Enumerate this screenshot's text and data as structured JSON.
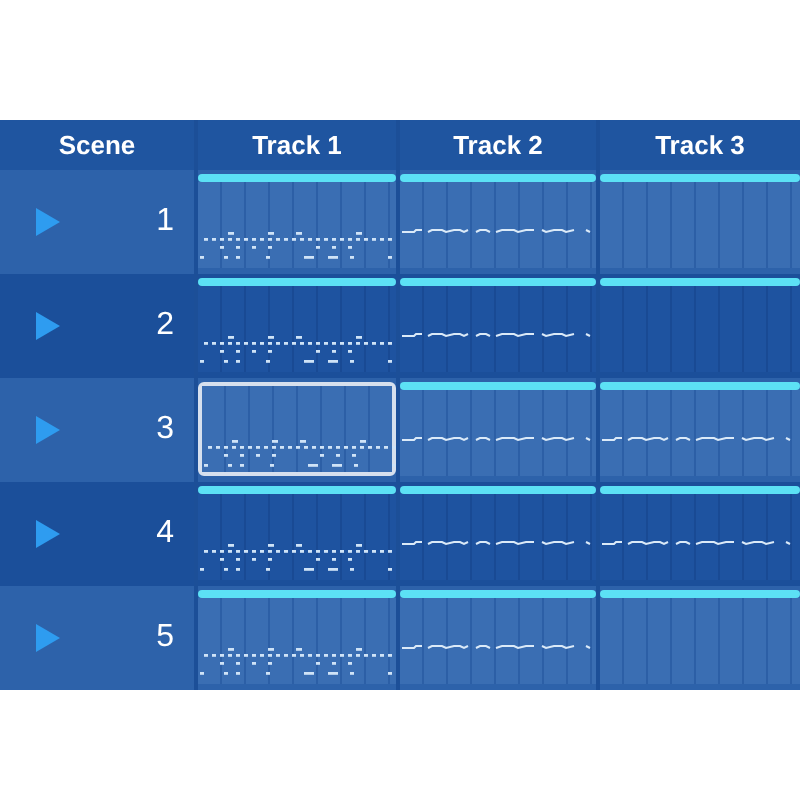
{
  "columns": [
    {
      "label": "Scene"
    },
    {
      "label": "Track 1"
    },
    {
      "label": "Track 2"
    },
    {
      "label": "Track 3"
    }
  ],
  "scenes": [
    {
      "number": "1",
      "cells": [
        {
          "kind": "drums",
          "selected": false
        },
        {
          "kind": "melody",
          "selected": false
        },
        {
          "kind": "empty",
          "selected": false
        }
      ]
    },
    {
      "number": "2",
      "cells": [
        {
          "kind": "drums",
          "selected": false
        },
        {
          "kind": "melody",
          "selected": false
        },
        {
          "kind": "empty",
          "selected": false
        }
      ]
    },
    {
      "number": "3",
      "cells": [
        {
          "kind": "drums",
          "selected": true
        },
        {
          "kind": "melody",
          "selected": false
        },
        {
          "kind": "melody",
          "selected": false
        }
      ]
    },
    {
      "number": "4",
      "cells": [
        {
          "kind": "drums",
          "selected": false
        },
        {
          "kind": "melody",
          "selected": false
        },
        {
          "kind": "melody",
          "selected": false
        }
      ]
    },
    {
      "number": "5",
      "cells": [
        {
          "kind": "drums",
          "selected": false
        },
        {
          "kind": "melody",
          "selected": false
        },
        {
          "kind": "empty",
          "selected": false
        }
      ]
    }
  ]
}
